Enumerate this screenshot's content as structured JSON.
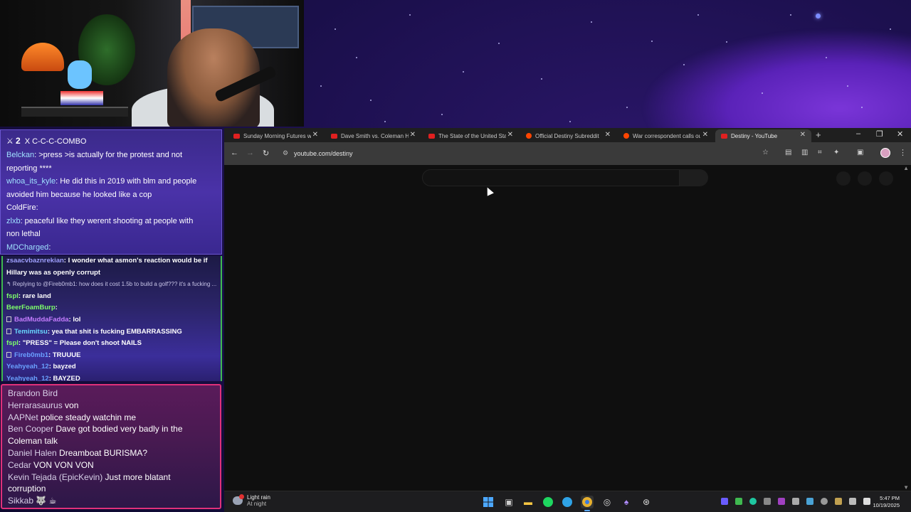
{
  "chat_top": {
    "combo_count": "2",
    "combo_label": "X C-C-C-COMBO",
    "messages": [
      {
        "user": "Belckan",
        "color": "#9fe0ff",
        "text": ": >press >is actually for the protest and not"
      },
      {
        "user": "",
        "color": "#ffffff",
        "text": "reporting ****"
      },
      {
        "user": "whoa_its_kyle",
        "color": "#9fe0ff",
        "text": ": He did this in 2019 with blm and people"
      },
      {
        "user": "",
        "color": "#ffffff",
        "text": "avoided him because he looked like a cop"
      },
      {
        "user": "ColdFire",
        "color": "#ffffff",
        "text": ": "
      },
      {
        "user": "zlxb",
        "color": "#9fe0ff",
        "text": ": peaceful like they werent shooting at people with"
      },
      {
        "user": "",
        "color": "#ffffff",
        "text": "non lethal"
      },
      {
        "user": "MDCharged",
        "color": "#9fe0ff",
        "text": ": "
      }
    ]
  },
  "chat_mid": {
    "messages": [
      {
        "user": "zsaacvbaznrekian",
        "color": "#9f9fff",
        "text": ": I wonder what asmon's reaction would be if"
      },
      {
        "user": "",
        "color": "#ffffff",
        "text": "Hillary was as openly corrupt"
      },
      {
        "reply": "↰ Replying to @Fireb0mb1: how does it cost 1.5b to build a golf??? it's a fucking ..."
      },
      {
        "user": "fspl",
        "color": "#7dff6a",
        "text": ": rare land"
      },
      {
        "user": "BeerFoamBurp",
        "color": "#7dff6a",
        "text": ": "
      },
      {
        "user": "BadMuddaFadda",
        "color": "#c57dff",
        "text": ": lol",
        "badge": true
      },
      {
        "user": "Temimitsu",
        "color": "#6ad8ff",
        "text": ": yea that shit is fucking EMBARRASSING",
        "badge": true
      },
      {
        "user": "fspl",
        "color": "#7dff6a",
        "text": ": \"PRESS\" = Please don't shoot NAILS"
      },
      {
        "user": "Fireb0mb1",
        "color": "#6aa0ff",
        "text": ": TRUUUE",
        "badge": true
      },
      {
        "user": "Yeahyeah_12",
        "color": "#6aa0ff",
        "text": ": bayzed"
      },
      {
        "user": "Yeahyeah_12",
        "color": "#6aa0ff",
        "text": ": BAYZED"
      }
    ]
  },
  "chat_bot": {
    "messages": [
      {
        "user": "Brandon Bird",
        "text": " "
      },
      {
        "user": "Herrarasaurus",
        "text": " von"
      },
      {
        "user": "AAPNet",
        "text": " police steady watchin me"
      },
      {
        "user": "Ben Cooper",
        "text": " Dave got bodied very badly in the"
      },
      {
        "user": "",
        "text": "Coleman talk"
      },
      {
        "user": "Daniel Halen",
        "text": " Dreamboat BURISMA?"
      },
      {
        "user": "Cedar",
        "text": " VON VON VON"
      },
      {
        "user": "Kevin Tejada (EpicKevin)",
        "text": " Just more blatant"
      },
      {
        "user": "",
        "text": "corruption"
      },
      {
        "user": "Sikkab",
        "text": " 🐺 ☕"
      }
    ]
  },
  "browser": {
    "tabs": [
      {
        "title": "Sunday Morning Futures wi",
        "fav": "yt"
      },
      {
        "title": "Dave Smith vs. Coleman Hu",
        "fav": "yt"
      },
      {
        "title": "The State of the United Sta",
        "fav": "yt"
      },
      {
        "title": "Official Destiny Subreddit",
        "fav": "rd"
      },
      {
        "title": "War correspondent calls ou",
        "fav": "rd"
      },
      {
        "title": "Destiny - YouTube",
        "fav": "yt",
        "active": true
      }
    ],
    "new_tab": "+",
    "url": "youtube.com/destiny"
  },
  "taskbar": {
    "weather_title": "Light rain",
    "weather_sub": "At night",
    "time": "5:47 PM",
    "date": "10/19/2025"
  }
}
